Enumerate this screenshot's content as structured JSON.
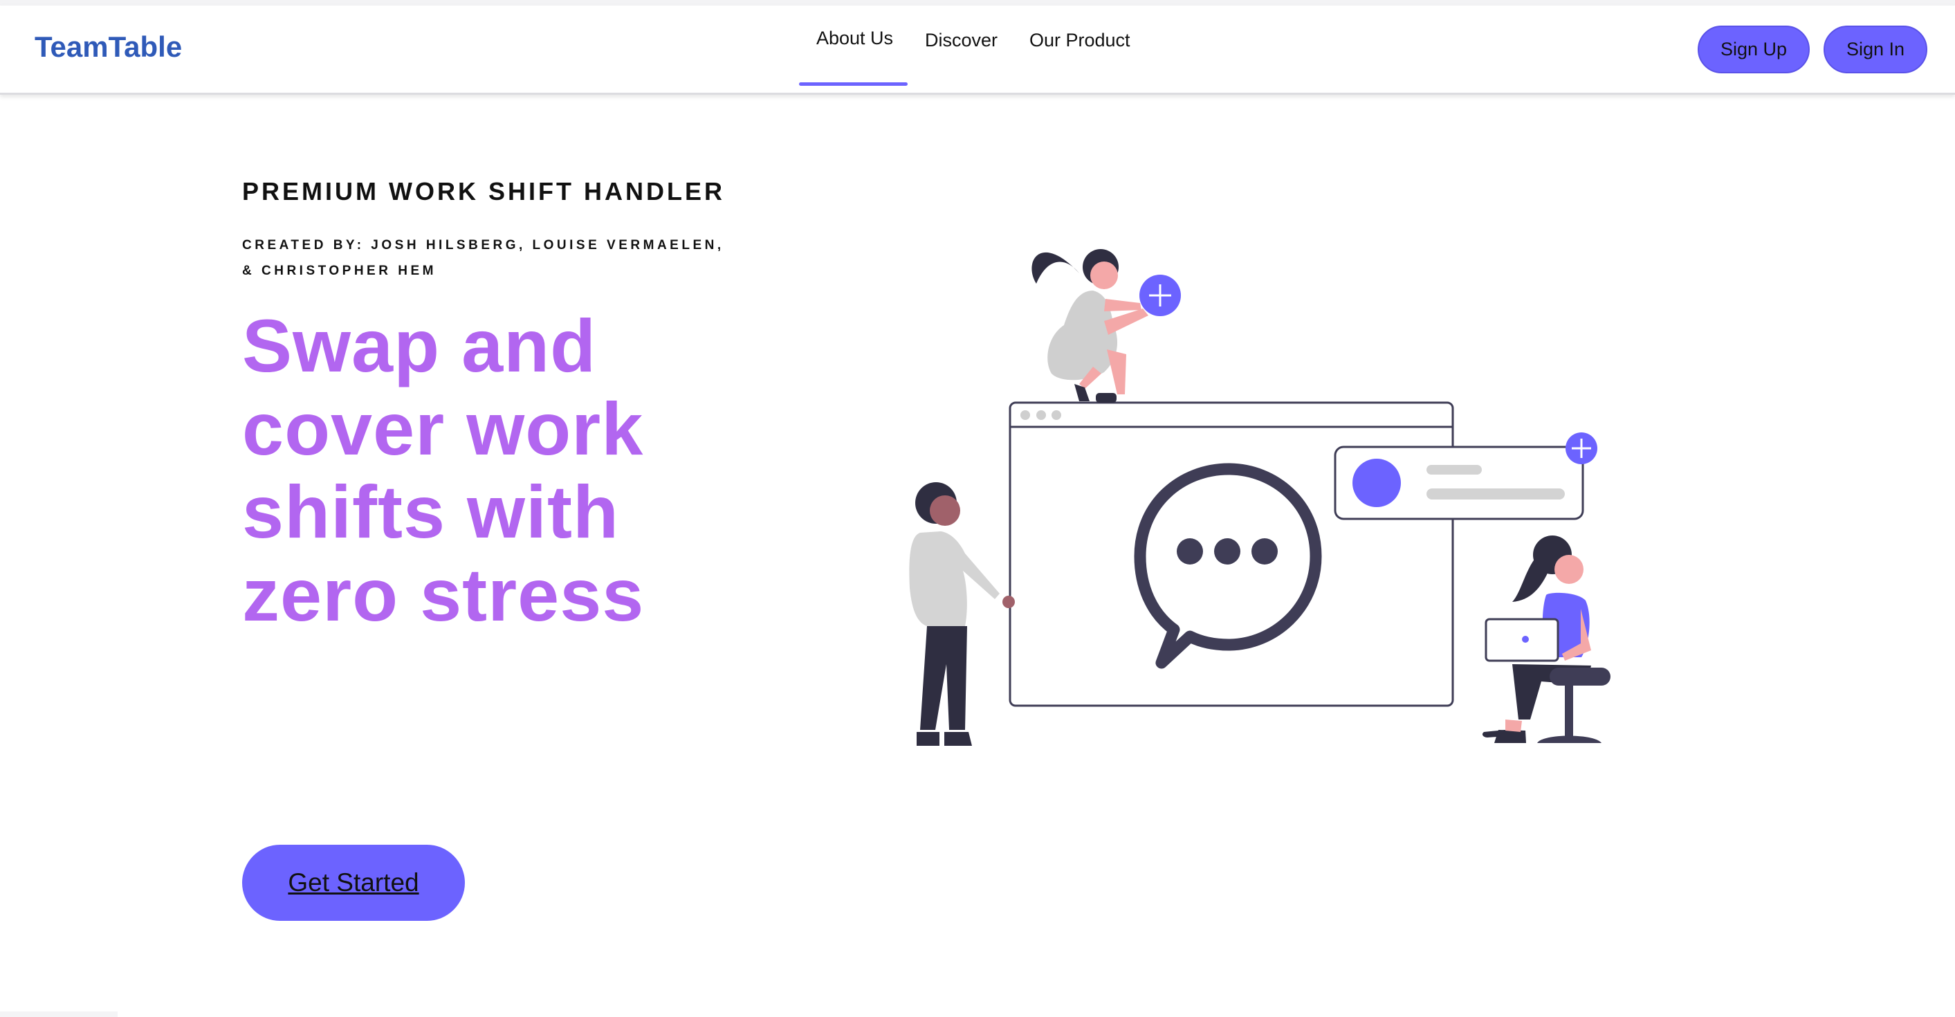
{
  "header": {
    "brand": "TeamTable",
    "nav": [
      {
        "label": "About Us",
        "active": true
      },
      {
        "label": "Discover",
        "active": false
      },
      {
        "label": "Our Product",
        "active": false
      }
    ],
    "sign_up_label": "Sign Up",
    "sign_in_label": "Sign In"
  },
  "hero": {
    "eyebrow": "PREMIUM WORK SHIFT HANDLER",
    "credits": "CREATED BY: JOSH HILSBERG, LOUISE VERMAELEN, & CHRISTOPHER HEM",
    "headline": "Swap and cover work shifts with zero stress",
    "cta_label": "Get Started"
  },
  "illustration": {
    "icons": [
      "browser-window-icon",
      "chat-bubble-icon",
      "plus-icon",
      "profile-card-icon",
      "laptop-icon"
    ]
  },
  "colors": {
    "accent": "#6c63ff",
    "brand": "#2f5ab8",
    "headline": "#b266f0",
    "dark": "#2f2e41",
    "skin": "#f4a8a8",
    "gray": "#cfcfcf"
  }
}
